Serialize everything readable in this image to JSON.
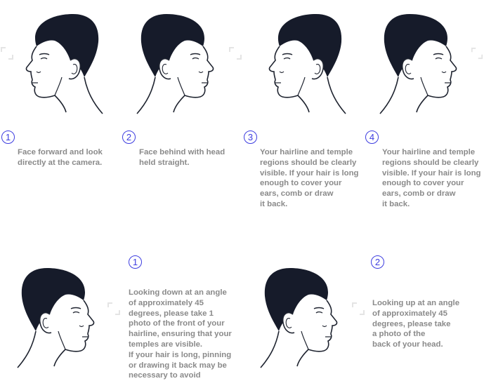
{
  "top_row": [
    {
      "number": "1",
      "caption": "Face forward and look\ndirectly at the camera."
    },
    {
      "number": "2",
      "caption": "Face behind with head\nheld straight."
    },
    {
      "number": "3",
      "caption": "Your hairline and temple\nregions should be clearly\nvisible. If your hair is long\nenough to cover your\nears, comb or draw\nit back."
    },
    {
      "number": "4",
      "caption": "Your hairline and temple\nregions should be clearly\nvisible. If your hair is long\nenough to cover your\nears, comb or draw\nit back."
    }
  ],
  "bottom_row": [
    {
      "number": "1",
      "caption": "Looking down at an angle\nof approximately 45\ndegrees, please take 1\nphoto of the front of your\nhairline, ensuring that your\ntemples are visible.\nIf your hair is long, pinning\nor drawing it back may be\nnecessary to avoid"
    },
    {
      "number": "2",
      "caption": "Looking up at an angle\nof approximately 45\ndegrees, please take\na photo of the\nback of your head."
    }
  ],
  "colors": {
    "accent": "#3d3de0",
    "caption": "#8a8a8a",
    "hair": "#161b2a",
    "outline": "#1f2430"
  },
  "icons": [
    "head-profile-left-icon",
    "head-profile-right-icon",
    "numbered-circle-icon"
  ]
}
